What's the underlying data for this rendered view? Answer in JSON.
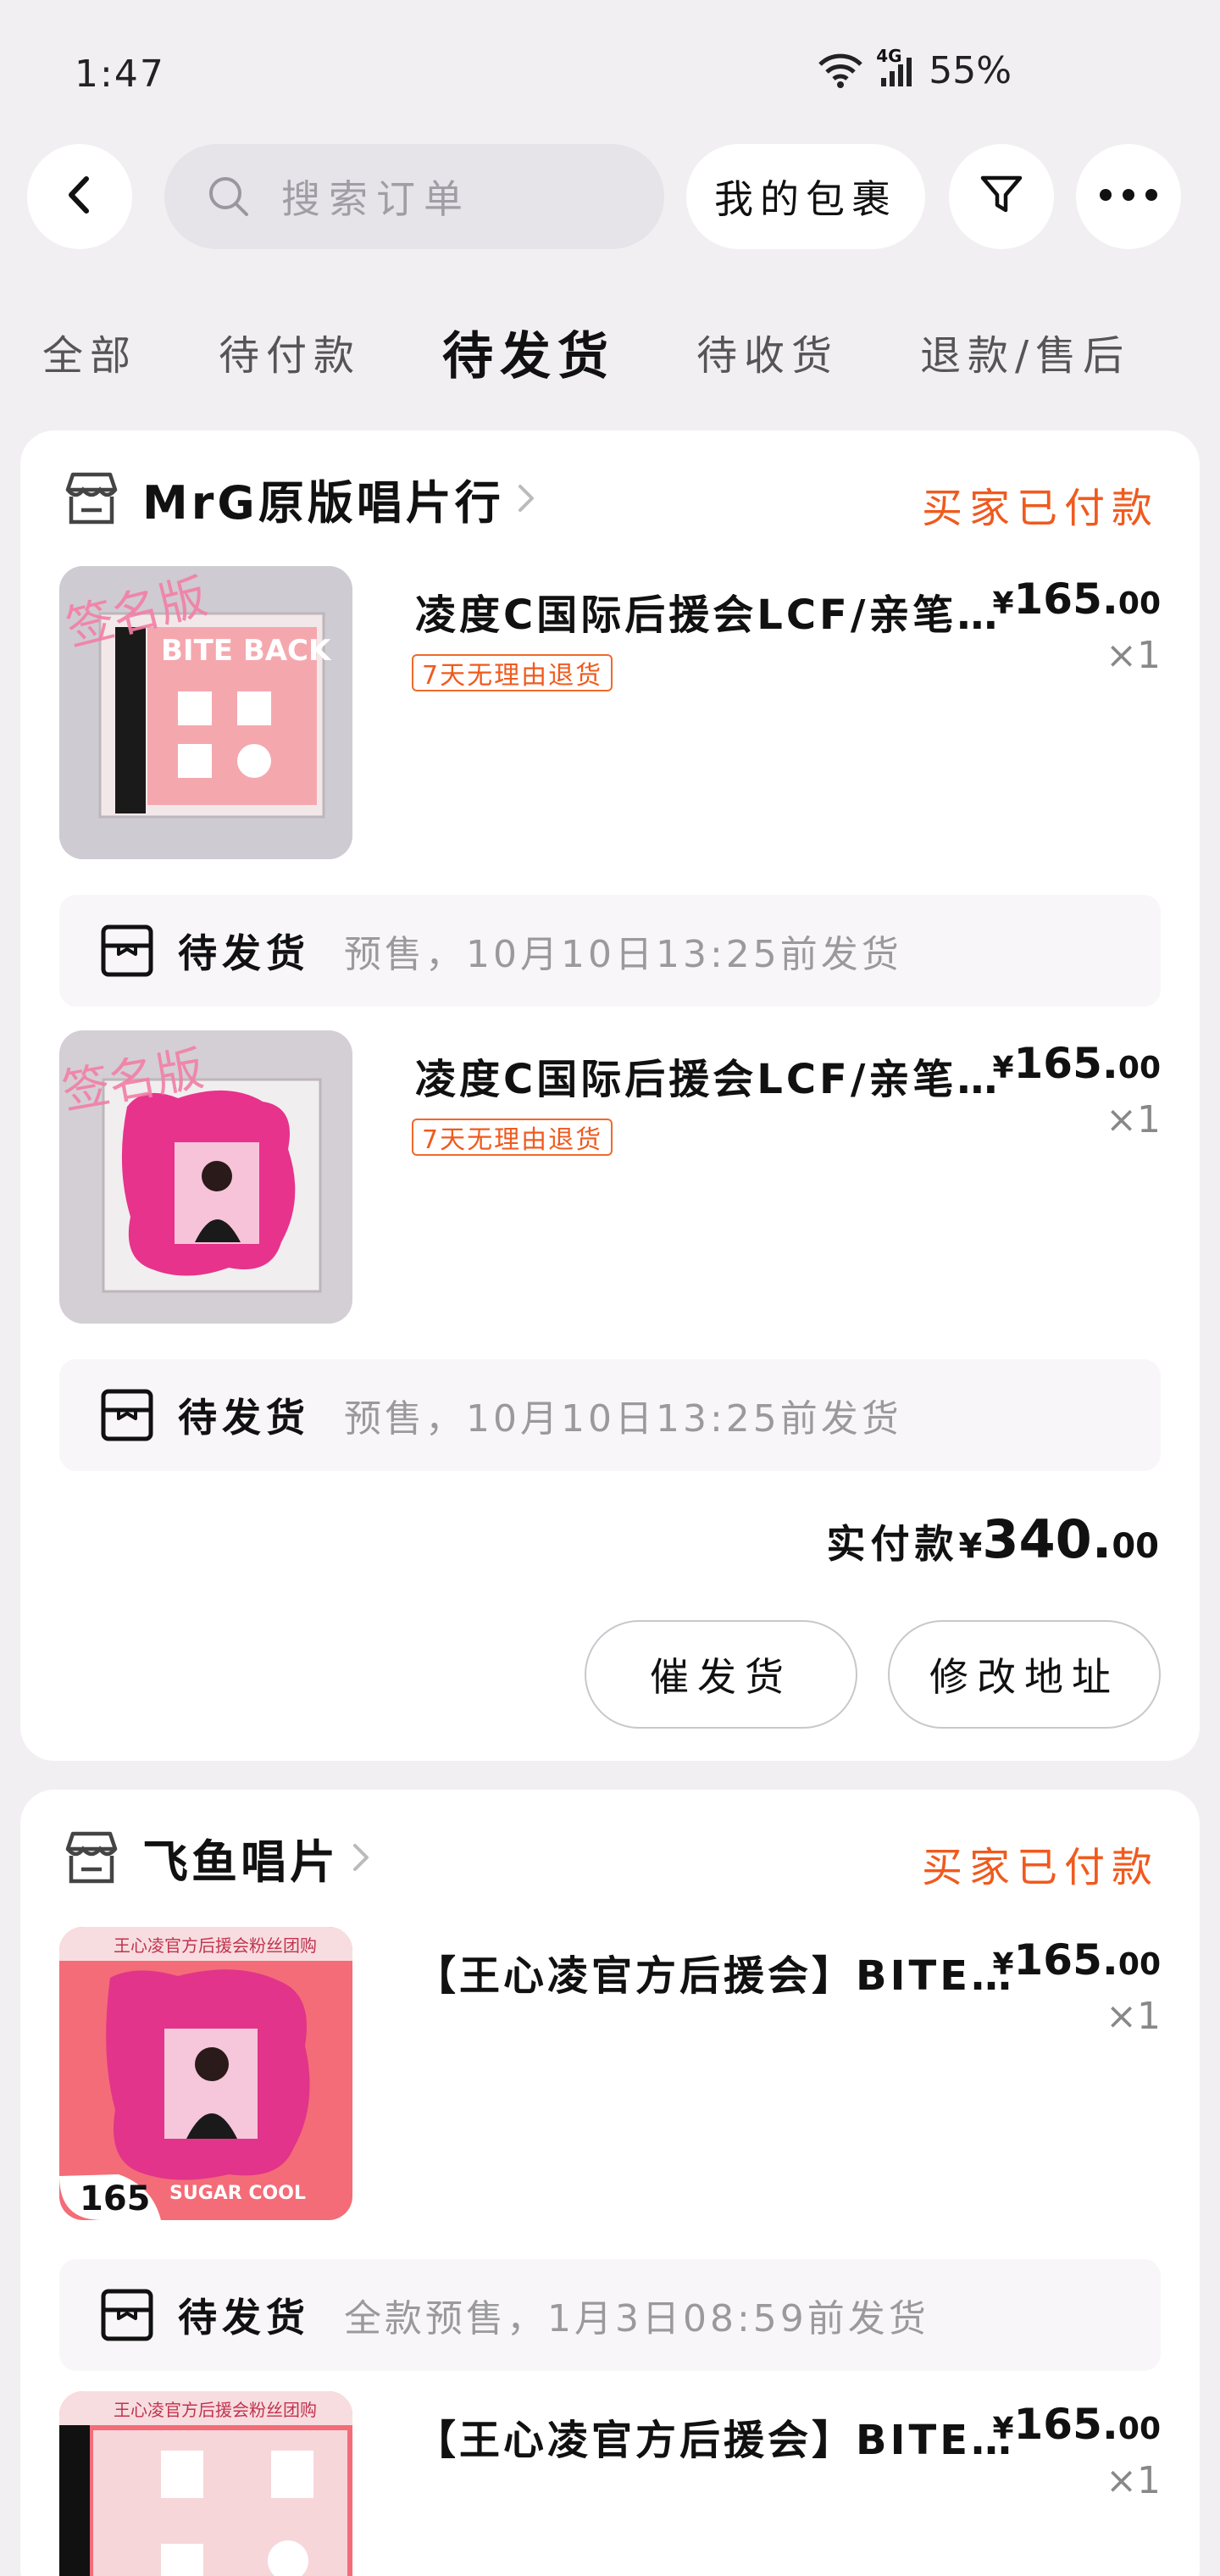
{
  "status_bar": {
    "time": "1:47",
    "network": "4G",
    "battery": "55%"
  },
  "search": {
    "placeholder": "搜索订单"
  },
  "header": {
    "my_packages": "我的包裹"
  },
  "tabs": [
    "全部",
    "待付款",
    "待发货",
    "待收货",
    "退款/售后"
  ],
  "active_tab": "待发货",
  "orders": [
    {
      "shop_name": "MrG原版唱片行",
      "status": "买家已付款",
      "items": [
        {
          "title": "凌度C国际后援会LCF/亲笔…",
          "tag": "7天无理由退货",
          "price_currency": "¥",
          "price_int": "165.",
          "price_dec": "00",
          "qty": "×1",
          "thumb_watermark": "签名版",
          "thumb_label": "BITE BACK",
          "ship_status": "待发货",
          "ship_note": "预售，10月10日13:25前发货"
        },
        {
          "title": "凌度C国际后援会LCF/亲笔…",
          "tag": "7天无理由退货",
          "price_currency": "¥",
          "price_int": "165.",
          "price_dec": "00",
          "qty": "×1",
          "thumb_watermark": "签名版",
          "ship_status": "待发货",
          "ship_note": "预售，10月10日13:25前发货"
        }
      ],
      "total_label": "实付款",
      "total_currency": "¥",
      "total_int": "340.",
      "total_dec": "00",
      "actions": [
        "催发货",
        "修改地址"
      ]
    },
    {
      "shop_name": "飞鱼唱片",
      "status": "买家已付款",
      "items": [
        {
          "title": "【王心凌官方后援会】BITE…",
          "price_currency": "¥",
          "price_int": "165.",
          "price_dec": "00",
          "qty": "×1",
          "thumb_banner": "王心凌官方后援会粉丝团购",
          "thumb_price": "165",
          "thumb_footer": "SUGAR COOL",
          "ship_status": "待发货",
          "ship_note": "全款预售，1月3日08:59前发货"
        },
        {
          "title": "【王心凌官方后援会】BITE…",
          "price_currency": "¥",
          "price_int": "165.",
          "price_dec": "00",
          "qty": "×1",
          "thumb_banner": "王心凌官方后援会粉丝团购"
        }
      ]
    }
  ],
  "colors": {
    "accent": "#f05a1e",
    "background": "#f1eff2",
    "card": "#ffffff"
  }
}
